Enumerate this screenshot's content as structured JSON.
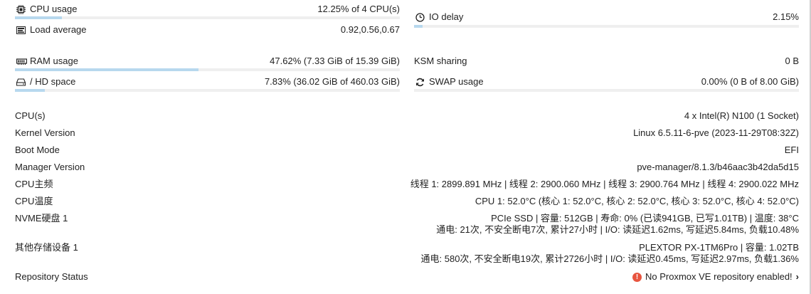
{
  "metrics": {
    "cpu": {
      "label": "CPU usage",
      "value": "12.25% of 4 CPU(s)",
      "percent": 12.25
    },
    "io_delay": {
      "label": "IO delay",
      "value": "2.15%",
      "percent": 2.15
    },
    "load": {
      "label": "Load average",
      "value": "0.92,0.56,0.67"
    },
    "ram": {
      "label": "RAM usage",
      "value": "47.62% (7.33 GiB of 15.39 GiB)",
      "percent": 47.62
    },
    "ksm": {
      "label": "KSM sharing",
      "value": "0 B"
    },
    "hd": {
      "label": "/ HD space",
      "value": "7.83% (36.02 GiB of 460.03 GiB)",
      "percent": 7.83
    },
    "swap": {
      "label": "SWAP usage",
      "value": "0.00% (0 B of 8.00 GiB)",
      "percent": 0
    }
  },
  "info": [
    {
      "key": "CPU(s)",
      "lines": [
        "4 x Intel(R) N100 (1 Socket)"
      ]
    },
    {
      "key": "Kernel Version",
      "lines": [
        "Linux 6.5.11-6-pve (2023-11-29T08:32Z)"
      ]
    },
    {
      "key": "Boot Mode",
      "lines": [
        "EFI"
      ]
    },
    {
      "key": "Manager Version",
      "lines": [
        "pve-manager/8.1.3/b46aac3b42da5d15"
      ]
    },
    {
      "key": "CPU主频",
      "lines": [
        "线程 1: 2899.891 MHz | 线程 2: 2900.060 MHz | 线程 3: 2900.764 MHz | 线程 4: 2900.022 MHz"
      ]
    },
    {
      "key": "CPU温度",
      "lines": [
        "CPU 1: 52.0°C (核心 1: 52.0°C, 核心 2: 52.0°C, 核心 3: 52.0°C, 核心 4: 52.0°C)"
      ]
    },
    {
      "key": "NVME硬盘 1",
      "lines": [
        "PCIe SSD | 容量: 512GB | 寿命: 0% (已读941GB, 已写1.01TB) | 温度: 38°C",
        "通电: 21次, 不安全断电7次, 累计27小时 | I/O: 读延迟1.62ms, 写延迟5.84ms, 负载10.48%"
      ]
    },
    {
      "key": "其他存储设备 1",
      "lines": [
        "PLEXTOR PX-1TM6Pro | 容量: 1.02TB",
        "通电: 580次, 不安全断电19次, 累计2726小时 | I/O: 读延迟0.45ms, 写延迟2.97ms, 负载1.36%"
      ]
    },
    {
      "key": "Repository Status",
      "lines": [
        "No Proxmox VE repository enabled!"
      ]
    }
  ],
  "colors": {
    "bar_fill": "#b7d8ee",
    "bar_track": "#efefef",
    "error": "#e8553f"
  }
}
